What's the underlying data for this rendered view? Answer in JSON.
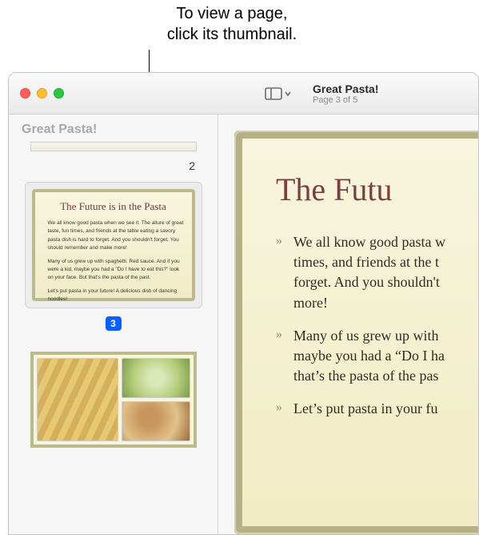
{
  "callout": {
    "line1": "To view a page,",
    "line2": "click its thumbnail."
  },
  "window": {
    "title": "Great Pasta!",
    "subtitle": "Page 3 of 5"
  },
  "sidebar": {
    "title": "Great Pasta!",
    "page_number_2": "2",
    "selected_badge": "3",
    "thumb3": {
      "title": "The Future is in the Pasta",
      "bullet1": "We all know good pasta when we see it. The allure of great taste, fun times, and friends at the table eating a savory pasta dish is hard to forget. And you shouldn't forget. You should remember and make more!",
      "bullet2": "Many of us grew up with spaghetti. Red sauce. And if you were a kid, maybe you had a \"Do I have to eat this?\" look on your face. But that's the pasta of the past.",
      "bullet3": "Let's put pasta in your future! A delicious dish of dancing noodles!"
    }
  },
  "main": {
    "heading": "The Futu",
    "bullet1": "We all know good pasta w\ntimes, and friends at the t\nforget. And you shouldn't\nmore!",
    "bullet2": "Many of us grew up with\nmaybe you had a “Do I ha\nthat’s the pasta of the pas",
    "bullet3": "Let’s put pasta in your fu"
  }
}
